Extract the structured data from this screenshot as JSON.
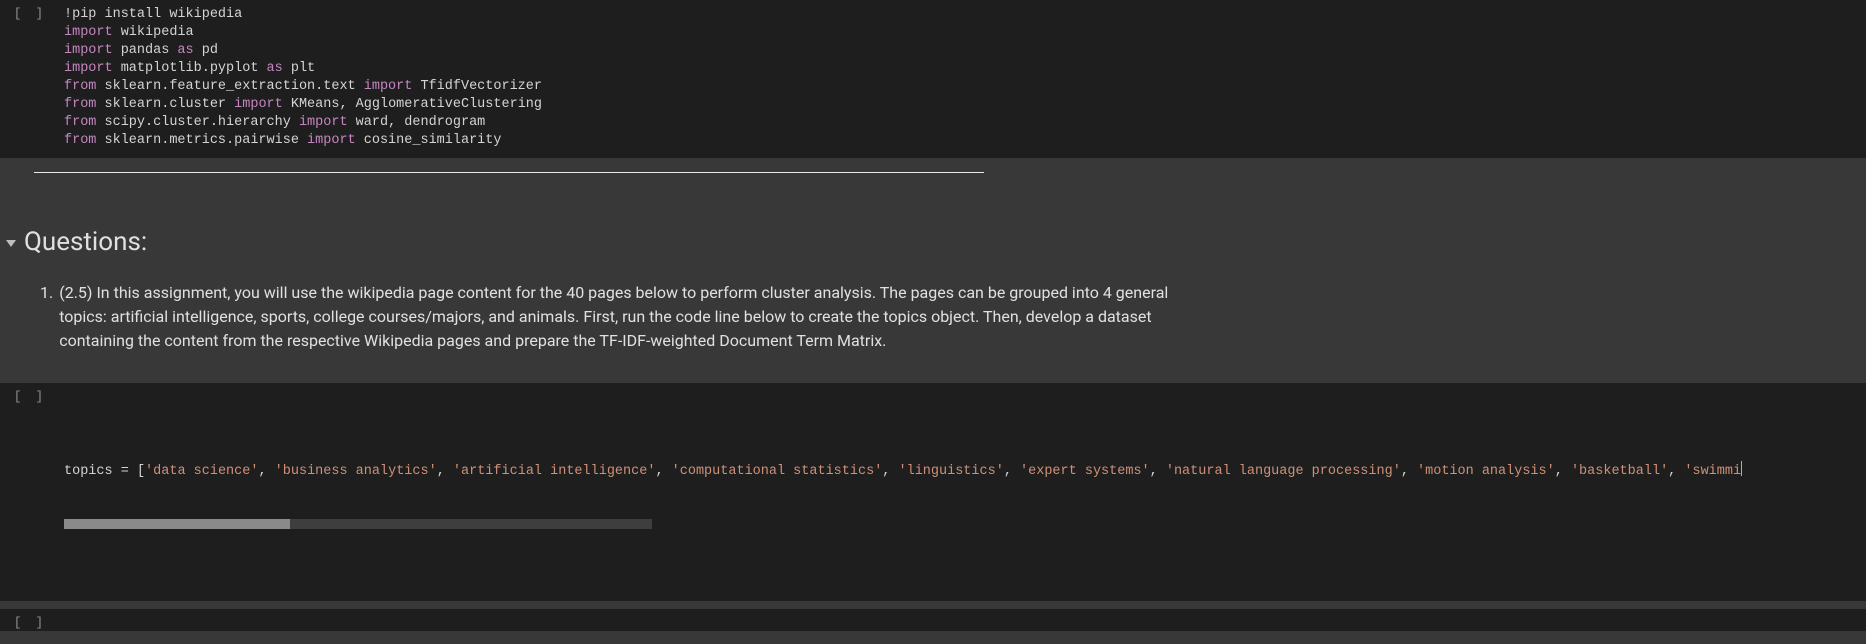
{
  "cells": [
    {
      "type": "code",
      "prompt": "[ ]",
      "code_lines": [
        [
          {
            "t": "!pip install wikipedia",
            "c": "id"
          }
        ],
        [
          {
            "t": "import",
            "c": "kw-import"
          },
          {
            "t": " wikipedia",
            "c": "id"
          }
        ],
        [
          {
            "t": "import",
            "c": "kw-import"
          },
          {
            "t": " pandas ",
            "c": "id"
          },
          {
            "t": "as",
            "c": "kw-import"
          },
          {
            "t": " pd",
            "c": "id"
          }
        ],
        [
          {
            "t": "import",
            "c": "kw-import"
          },
          {
            "t": " matplotlib.pyplot ",
            "c": "id"
          },
          {
            "t": "as",
            "c": "kw-import"
          },
          {
            "t": " plt",
            "c": "id"
          }
        ],
        [
          {
            "t": "from",
            "c": "kw-import"
          },
          {
            "t": " sklearn.feature_extraction.text ",
            "c": "id"
          },
          {
            "t": "import",
            "c": "kw-import"
          },
          {
            "t": " TfidfVectorizer",
            "c": "id"
          }
        ],
        [
          {
            "t": "from",
            "c": "kw-import"
          },
          {
            "t": " sklearn.cluster ",
            "c": "id"
          },
          {
            "t": "import",
            "c": "kw-import"
          },
          {
            "t": " KMeans, AgglomerativeClustering",
            "c": "id"
          }
        ],
        [
          {
            "t": "from",
            "c": "kw-import"
          },
          {
            "t": " scipy.cluster.hierarchy ",
            "c": "id"
          },
          {
            "t": "import",
            "c": "kw-import"
          },
          {
            "t": " ward, dendrogram",
            "c": "id"
          }
        ],
        [
          {
            "t": "from",
            "c": "kw-import"
          },
          {
            "t": " sklearn.metrics.pairwise ",
            "c": "id"
          },
          {
            "t": "import",
            "c": "kw-import"
          },
          {
            "t": " cosine_similarity",
            "c": "id"
          }
        ]
      ]
    }
  ],
  "section": {
    "title": "Questions:"
  },
  "question": {
    "number": "1.",
    "text": "(2.5) In this assignment, you will use the wikipedia page content for the 40 pages below to perform cluster analysis. The pages can be grouped into 4 general topics: artificial intelligence, sports, college courses/majors, and animals. First, run the code line below to create the topics object. Then, develop a dataset containing the content from the respective Wikipedia pages and prepare the TF-IDF-weighted Document Term Matrix."
  },
  "topics_cell": {
    "prompt": "[ ]",
    "prefix": "topics = [",
    "items": [
      "'data science'",
      "'business analytics'",
      "'artificial intelligence'",
      "'computational statistics'",
      "'linguistics'",
      "'expert systems'",
      "'natural language processing'",
      "'motion analysis'",
      "'basketball'",
      "'swimmi"
    ]
  },
  "empty_cell": {
    "prompt": "[ ]"
  }
}
